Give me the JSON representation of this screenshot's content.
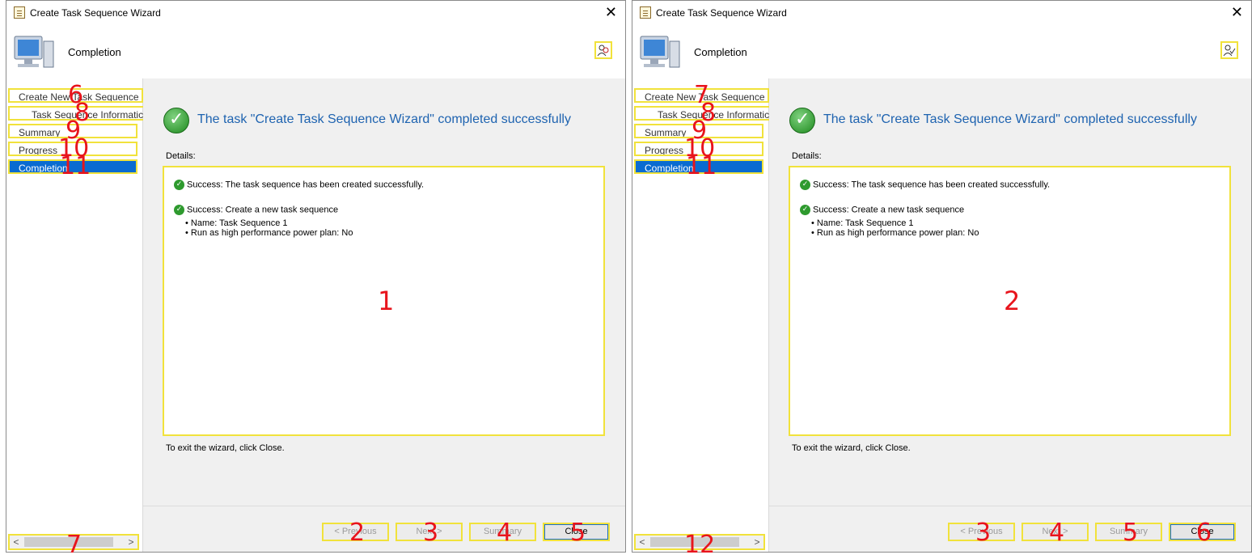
{
  "left": {
    "window_title": "Create Task Sequence Wizard",
    "page_heading": "Completion",
    "nav": [
      {
        "label": "Create New Task Sequence",
        "marker": "6"
      },
      {
        "label": "Task Sequence Informatic",
        "marker": "8"
      },
      {
        "label": "Summary",
        "marker": "9"
      },
      {
        "label": "Progress",
        "marker": "10"
      },
      {
        "label": "Completion",
        "marker": "11"
      }
    ],
    "scroll_marker": "7",
    "success_title": "The task \"Create Task Sequence Wizard\" completed successfully",
    "details_label": "Details:",
    "details": {
      "line1": "Success: The task sequence has been created successfully.",
      "line2": "Success: Create a new task sequence",
      "bullet1": "•  Name: Task Sequence 1",
      "bullet2": "•  Run as high performance power plan: No"
    },
    "details_marker": "1",
    "exit_note": "To exit the wizard, click Close.",
    "buttons": {
      "previous": "< Previous",
      "next": "Next >",
      "summary": "Summary",
      "close": "Close",
      "previous_marker": "2",
      "next_marker": "3",
      "summary_marker": "4",
      "close_marker": "5"
    }
  },
  "right": {
    "window_title": "Create Task Sequence Wizard",
    "page_heading": "Completion",
    "nav": [
      {
        "label": "Create New Task Sequence",
        "marker": "7"
      },
      {
        "label": "Task Sequence Informatic",
        "marker": "8"
      },
      {
        "label": "Summary",
        "marker": "9"
      },
      {
        "label": "Progress",
        "marker": "10"
      },
      {
        "label": "Completion",
        "marker": "11"
      }
    ],
    "scroll_marker": "12",
    "success_title": "The task \"Create Task Sequence Wizard\" completed successfully",
    "details_label": "Details:",
    "details": {
      "line1": "Success: The task sequence has been created successfully.",
      "line2": "Success: Create a new task sequence",
      "bullet1": "•  Name: Task Sequence 1",
      "bullet2": "•  Run as high performance power plan: No"
    },
    "details_marker": "2",
    "exit_note": "To exit the wizard, click Close.",
    "buttons": {
      "previous": "< Previous",
      "next": "Next >",
      "summary": "Summary",
      "close": "Close",
      "previous_marker": "3",
      "next_marker": "4",
      "summary_marker": "5",
      "close_marker": "6"
    }
  },
  "colors": {
    "highlight": "#f1e23b",
    "marker": "#e8141c",
    "selected": "#0a6bd1",
    "title_blue": "#1e63b0"
  }
}
